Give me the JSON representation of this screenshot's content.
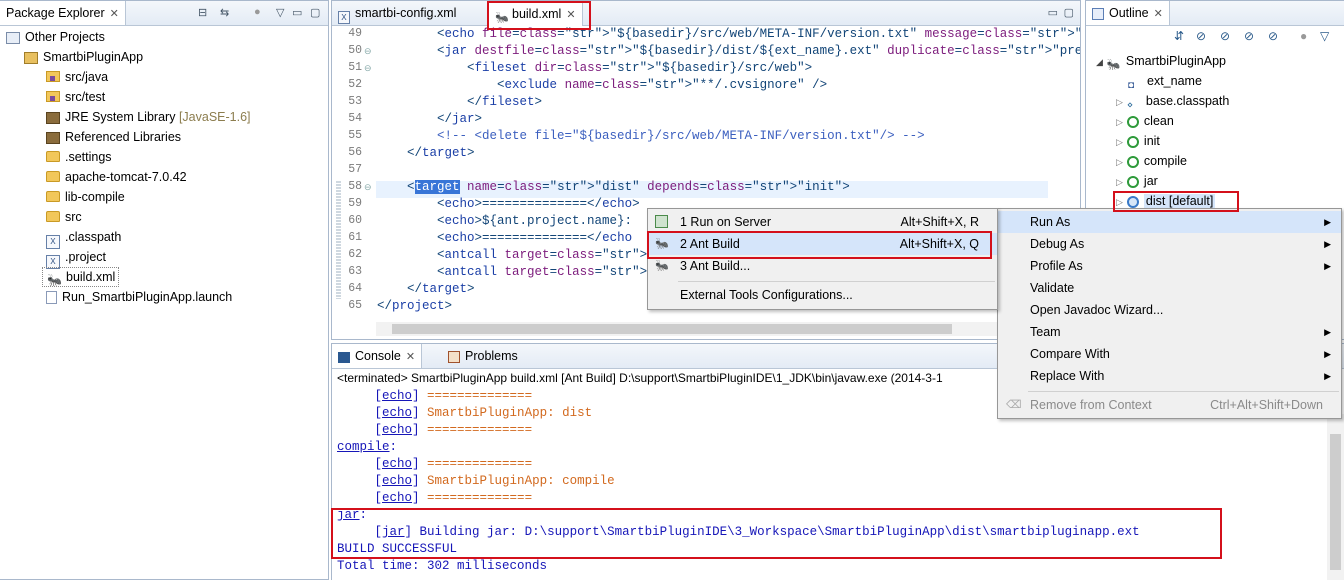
{
  "package_explorer": {
    "title": "Package Explorer",
    "items": [
      {
        "label": "Other Projects",
        "icon": "working-set-icon"
      },
      {
        "label": "SmartbiPluginApp",
        "icon": "project-icon"
      },
      {
        "label": "src/java",
        "icon": "source-folder-icon"
      },
      {
        "label": "src/test",
        "icon": "source-folder-icon"
      },
      {
        "label": "JRE System Library",
        "suffix": "[JavaSE-1.6]",
        "icon": "library-icon"
      },
      {
        "label": "Referenced Libraries",
        "icon": "library-icon"
      },
      {
        "label": ".settings",
        "icon": "folder-icon"
      },
      {
        "label": "apache-tomcat-7.0.42",
        "icon": "folder-icon"
      },
      {
        "label": "lib-compile",
        "icon": "folder-icon"
      },
      {
        "label": "src",
        "icon": "folder-icon"
      },
      {
        "label": ".classpath",
        "icon": "xml-file-icon"
      },
      {
        "label": ".project",
        "icon": "xml-file-icon"
      },
      {
        "label": "build.xml",
        "icon": "ant-file-icon"
      },
      {
        "label": "Run_SmartbiPluginApp.launch",
        "icon": "launch-file-icon"
      }
    ]
  },
  "editor": {
    "tabs": [
      "smartbi-config.xml",
      "build.xml"
    ],
    "lines": [
      {
        "n": "49",
        "text": "        <echo file=\"${basedir}/src/web/META-INF/version.txt\" message=\"${today}\" />"
      },
      {
        "n": "50",
        "text": "        <jar destfile=\"${basedir}/dist/${ext_name}.ext\" duplicate=\"preserve\">"
      },
      {
        "n": "51",
        "text": "            <fileset dir=\"${basedir}/src/web\">"
      },
      {
        "n": "52",
        "text": "                <exclude name=\"**/.cvsignore\" />"
      },
      {
        "n": "53",
        "text": "            </fileset>"
      },
      {
        "n": "54",
        "text": "        </jar>"
      },
      {
        "n": "55",
        "text": "        <!-- <delete file=\"${basedir}/src/web/META-INF/version.txt\"/> -->"
      },
      {
        "n": "56",
        "text": "    </target>"
      },
      {
        "n": "57",
        "text": ""
      },
      {
        "n": "58",
        "text": "    <target name=\"dist\" depends=\"init\">"
      },
      {
        "n": "59",
        "text": "        <echo>==============</echo>"
      },
      {
        "n": "60",
        "text": "        <echo>${ant.project.name}:"
      },
      {
        "n": "61",
        "text": "        <echo>==============</echo"
      },
      {
        "n": "62",
        "text": "        <antcall target=\"compile\""
      },
      {
        "n": "63",
        "text": "        <antcall target=\"jar\" />"
      },
      {
        "n": "64",
        "text": "    </target>"
      },
      {
        "n": "65",
        "text": "</project>"
      }
    ]
  },
  "outline": {
    "title": "Outline",
    "items": [
      {
        "label": "SmartbiPluginApp",
        "icon": "ant-project-icon"
      },
      {
        "label": "ext_name",
        "icon": "property-icon"
      },
      {
        "label": "base.classpath",
        "icon": "path-icon"
      },
      {
        "label": "clean",
        "icon": "target-icon"
      },
      {
        "label": "init",
        "icon": "target-icon"
      },
      {
        "label": "compile",
        "icon": "target-icon"
      },
      {
        "label": "jar",
        "icon": "target-icon"
      },
      {
        "label": "dist [default]",
        "icon": "default-target-icon"
      }
    ]
  },
  "console": {
    "tabs": [
      "Console",
      "Problems"
    ],
    "status": "<terminated> SmartbiPluginApp build.xml [Ant Build] D:\\support\\SmartbiPluginIDE\\1_JDK\\bin\\javaw.exe (2014-3-1",
    "lines": [
      {
        "task": "echo",
        "text": "==============",
        "color": "orange"
      },
      {
        "task": "echo",
        "text": "SmartbiPluginApp: dist",
        "color": "orange"
      },
      {
        "task": "echo",
        "text": "==============",
        "color": "orange"
      },
      {
        "target": "compile:"
      },
      {
        "task": "echo",
        "text": "==============",
        "color": "orange"
      },
      {
        "task": "echo",
        "text": "SmartbiPluginApp: compile",
        "color": "orange"
      },
      {
        "task": "echo",
        "text": "==============",
        "color": "orange"
      },
      {
        "target": "jar:"
      },
      {
        "task": "jar",
        "text": "Building jar: D:\\support\\SmartbiPluginIDE\\3_Workspace\\SmartbiPluginApp\\dist\\smartbipluginapp.ext",
        "color": "blue"
      },
      {
        "plain": "BUILD SUCCESSFUL"
      },
      {
        "plain": "Total time: 302 milliseconds"
      }
    ]
  },
  "context_menu": {
    "items": [
      {
        "label": "Run As",
        "submenu": true,
        "highlighted": true
      },
      {
        "label": "Debug As",
        "submenu": true
      },
      {
        "label": "Profile As",
        "submenu": true
      },
      {
        "label": "Validate"
      },
      {
        "label": "Open Javadoc Wizard..."
      },
      {
        "label": "Team",
        "submenu": true
      },
      {
        "label": "Compare With",
        "submenu": true
      },
      {
        "label": "Replace With",
        "submenu": true
      },
      {
        "label": "Remove from Context",
        "shortcut": "Ctrl+Alt+Shift+Down",
        "disabled": true
      }
    ]
  },
  "run_as_menu": {
    "items": [
      {
        "label": "1 Run on Server",
        "shortcut": "Alt+Shift+X, R",
        "icon": "server-run-icon"
      },
      {
        "label": "2 Ant Build",
        "shortcut": "Alt+Shift+X, Q",
        "icon": "ant-icon",
        "highlighted": true
      },
      {
        "label": "3 Ant Build...",
        "shortcut": "",
        "icon": "ant-icon"
      },
      {
        "label": "External Tools Configurations...",
        "shortcut": ""
      }
    ]
  },
  "colors": {
    "highlight_box": "#d4101b",
    "selection": "#3875d7",
    "console_blue": "#1616b8",
    "console_orange": "#d2691e"
  }
}
